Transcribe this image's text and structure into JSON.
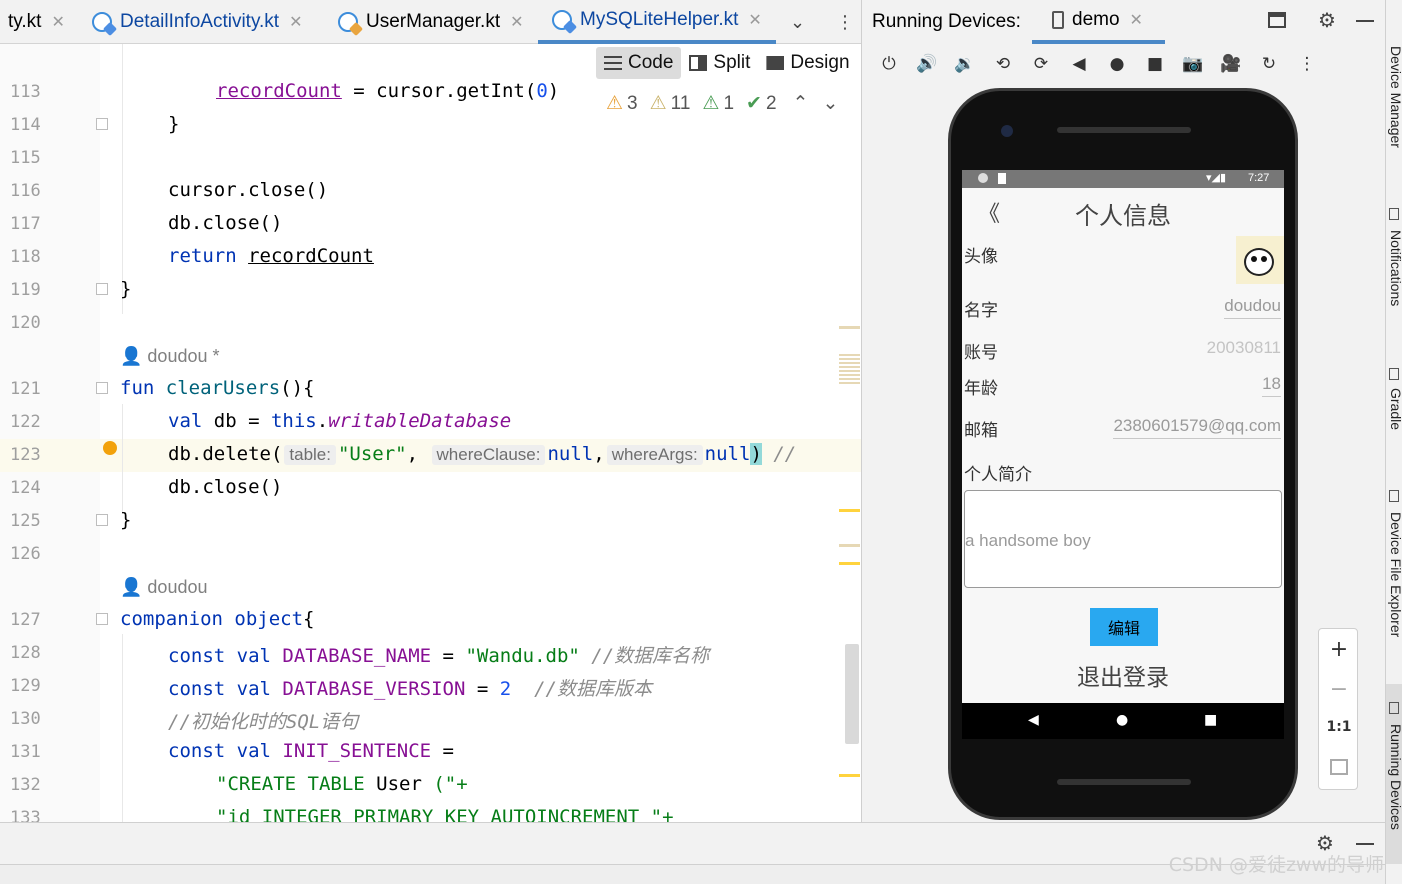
{
  "editor_tabs": [
    {
      "label": "ty.kt",
      "active": false
    },
    {
      "label": "DetailInfoActivity.kt",
      "active": false
    },
    {
      "label": "UserManager.kt",
      "active": false
    },
    {
      "label": "MySQLiteHelper.kt",
      "active": true
    }
  ],
  "view_modes": {
    "code": "Code",
    "split": "Split",
    "design": "Design"
  },
  "inspections": {
    "warn_a": "3",
    "warn_b": "11",
    "weak": "1",
    "typo": "2"
  },
  "lines": [
    {
      "n": "113"
    },
    {
      "n": "114"
    },
    {
      "n": "115"
    },
    {
      "n": "116"
    },
    {
      "n": "117"
    },
    {
      "n": "118"
    },
    {
      "n": "119"
    },
    {
      "n": "120"
    },
    {
      "n": "121"
    },
    {
      "n": "122"
    },
    {
      "n": "123"
    },
    {
      "n": "124"
    },
    {
      "n": "125"
    },
    {
      "n": "126"
    },
    {
      "n": "127"
    },
    {
      "n": "128"
    },
    {
      "n": "129"
    },
    {
      "n": "130"
    },
    {
      "n": "131"
    },
    {
      "n": "132"
    },
    {
      "n": "133"
    }
  ],
  "code": {
    "l113_a": "recordCount",
    "l113_b": " = cursor.getInt(",
    "l113_c": "0",
    "l113_d": ")",
    "l114": "}",
    "l116": "cursor.close()",
    "l117": "db.close()",
    "l118_kw": "return ",
    "l118_var": "recordCount",
    "l119": "}",
    "author1": "doudou *",
    "l121_kw": "fun ",
    "l121_fn": "clearUsers",
    "l121_rest": "(){",
    "l122_kw": "val",
    "l122_a": " db = ",
    "l122_this": "this",
    "l122_dot": ".",
    "l122_prop": "writableDatabase",
    "l123_a": "db.delete(",
    "l123_hint1": "table:",
    "l123_str": "\"User\"",
    "l123_comma": ", ",
    "l123_hint2": "whereClause:",
    "l123_null1": "null",
    "l123_comma2": ",",
    "l123_hint3": "whereArgs:",
    "l123_null2": "null",
    "l123_close": ")",
    "l123_cm": " //",
    "l124": "db.close()",
    "l125": "}",
    "author2": "doudou",
    "l127_kw": "companion object",
    "l127_b": "{",
    "l128_kw": "const val ",
    "l128_name": "DATABASE_NAME",
    "l128_eq": " = ",
    "l128_str": "\"Wandu.db\"",
    "l128_cm": " //数据库名称",
    "l129_kw": "const val ",
    "l129_name": "DATABASE_VERSION",
    "l129_eq": " = ",
    "l129_num": "2",
    "l129_cm": "  //数据库版本",
    "l130_cm": "//初始化时的SQL语句",
    "l131_kw": "const val ",
    "l131_name": "INIT_SENTENCE",
    "l131_eq": " =",
    "l132_str": "\"CREATE TABLE ",
    "l132_tbl": "User",
    "l132_str2": " (\"+",
    "l133": "\"id INTEGER PRIMARY KEY AUTOINCREMENT \"+"
  },
  "devices": {
    "title": "Running Devices:",
    "device_tab": "demo"
  },
  "app": {
    "status_time": "7:27",
    "back_glyph": "《",
    "title": "个人信息",
    "avatar_label": "头像",
    "name_label": "名字",
    "name_value": "doudou",
    "account_label": "账号",
    "account_value": "20030811",
    "age_label": "年龄",
    "age_value": "18",
    "email_label": "邮箱",
    "email_value": "2380601579@qq.com",
    "intro_label": "个人简介",
    "intro_value": "a handsome boy",
    "edit_button": "编辑",
    "logout": "退出登录"
  },
  "zoom": {
    "plus": "+",
    "minus": "−",
    "ratio": "1:1"
  },
  "side_tools": [
    "Device Manager",
    "Notifications",
    "Gradle",
    "Device File Explorer",
    "Running Devices"
  ],
  "watermark": "CSDN @爱徒zww的导师"
}
